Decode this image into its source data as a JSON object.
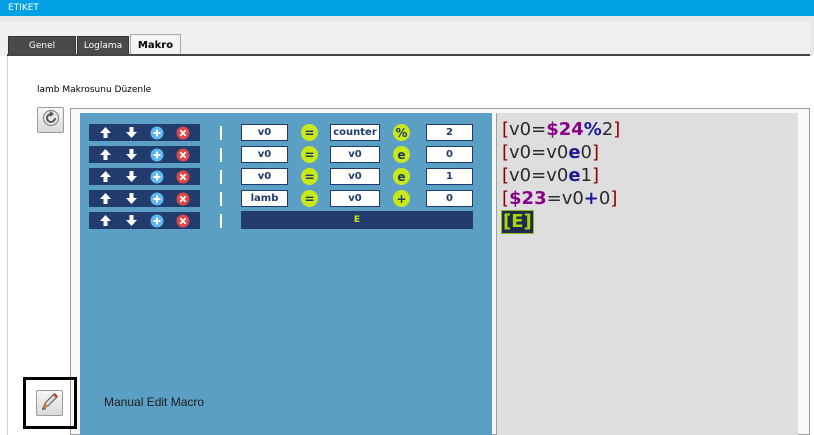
{
  "window": {
    "title": "ETIKET"
  },
  "tabs": [
    {
      "label": "Genel",
      "active": false
    },
    {
      "label": "Loglama",
      "active": false
    },
    {
      "label": "Makro",
      "active": true
    }
  ],
  "editor": {
    "title": "lamb Makrosunu Düzenle",
    "manual_edit_label": "Manual Edit Macro",
    "icons": {
      "refresh": "refresh-icon",
      "manual_edit": "pen-icon"
    }
  },
  "rows": [
    {
      "target": "v0",
      "assign": "=",
      "left": "counter",
      "op": "%",
      "right": "2"
    },
    {
      "target": "v0",
      "assign": "=",
      "left": "v0",
      "op": "e",
      "right": "0"
    },
    {
      "target": "v0",
      "assign": "=",
      "left": "v0",
      "op": "e",
      "right": "1"
    },
    {
      "target": "lamb",
      "assign": "=",
      "left": "v0",
      "op": "+",
      "right": "0"
    }
  ],
  "end_row": {
    "label": "E"
  },
  "code": {
    "line1": {
      "open": "[",
      "a": "v0=",
      "b": "$24",
      "c": "%",
      "d": "2",
      "close": "]"
    },
    "line2": {
      "open": "[",
      "a": "v0=v0",
      "c": "e",
      "d": "0",
      "close": "]"
    },
    "line3": {
      "open": "[",
      "a": "v0=v0",
      "c": "e",
      "d": "1",
      "close": "]"
    },
    "line4": {
      "open": "[",
      "b": "$23",
      "a": "=v0",
      "c": "+",
      "d": "0",
      "close": "]"
    },
    "line5": {
      "open": "[",
      "e": "E",
      "close": "]"
    }
  },
  "colors": {
    "titlebar": "#00a1e4",
    "panel_blue": "#5ba0c4",
    "navy": "#223c6e",
    "operator_green": "#c8e81a"
  }
}
